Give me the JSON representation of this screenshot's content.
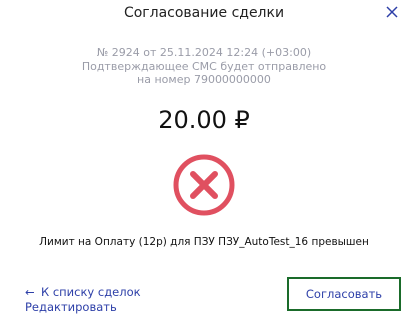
{
  "header": {
    "title": "Согласование сделки",
    "close_icon": "close-icon"
  },
  "deal": {
    "info_line": "№ 2924 от 25.11.2024 12:24 (+03:00)",
    "sms_line1": "Подтверждающее СМС будет отправлено",
    "sms_line2": "на номер 79000000000",
    "amount": "20.00 ₽"
  },
  "status": {
    "icon": "error-x-icon",
    "color": "#e05060",
    "message": "Лимит на Оплату (12р) для ПЗУ ПЗУ_AutoTest_16 превышен"
  },
  "footer": {
    "back_arrow": "←",
    "back_label": "К списку сделок",
    "edit_label": "Редактировать",
    "approve_label": "Согласовать"
  },
  "colors": {
    "accent": "#2d3fa8",
    "approve_border": "#1a6b2a",
    "meta_text": "#9a9ca8"
  }
}
